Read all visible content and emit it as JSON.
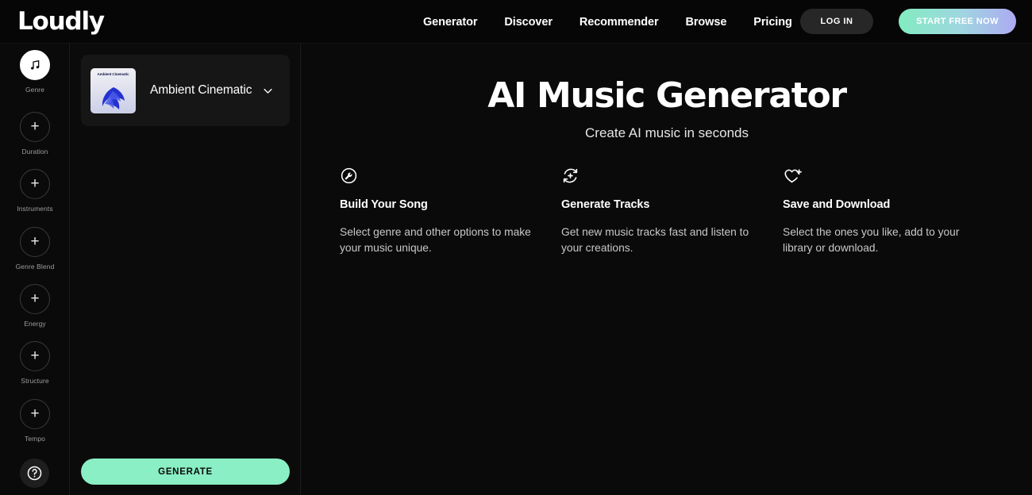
{
  "nav": {
    "logo": "Loudly",
    "links": [
      {
        "label": "Generator"
      },
      {
        "label": "Discover"
      },
      {
        "label": "Recommender"
      },
      {
        "label": "Browse"
      },
      {
        "label": "Pricing"
      }
    ],
    "login_label": "LOG IN",
    "cta_label": "START FREE NOW",
    "cta_gradient_from": "#82ecc0",
    "cta_gradient_to": "#adaaf2"
  },
  "sidebar": {
    "items": [
      {
        "label": "Genre",
        "icon": "music-note-icon",
        "active": true
      },
      {
        "label": "Duration",
        "icon": "plus-icon",
        "active": false
      },
      {
        "label": "Instruments",
        "icon": "plus-icon",
        "active": false
      },
      {
        "label": "Genre Blend",
        "icon": "plus-icon",
        "active": false
      },
      {
        "label": "Energy",
        "icon": "plus-icon",
        "active": false
      },
      {
        "label": "Structure",
        "icon": "plus-icon",
        "active": false
      },
      {
        "label": "Tempo",
        "icon": "plus-icon",
        "active": false
      }
    ],
    "help_icon": "question-mark-icon"
  },
  "panel": {
    "genre": {
      "name": "Ambient Cinematic",
      "thumbnail_title": "Ambient Cinematic",
      "chevron_icon": "chevron-down-icon"
    },
    "generate_label": "GENERATE",
    "generate_color": "#8aefc4"
  },
  "main": {
    "title": "AI Music Generator",
    "subtitle": "Create AI music in seconds",
    "features": [
      {
        "icon": "wrench-circle-icon",
        "title": "Build Your Song",
        "description": "Select genre and other options to make your music unique."
      },
      {
        "icon": "refresh-plus-icon",
        "title": "Generate Tracks",
        "description": "Get new music tracks fast and listen to your creations."
      },
      {
        "icon": "heart-plus-icon",
        "title": "Save and Download",
        "description": "Select the ones you like, add to your library or download."
      }
    ]
  }
}
